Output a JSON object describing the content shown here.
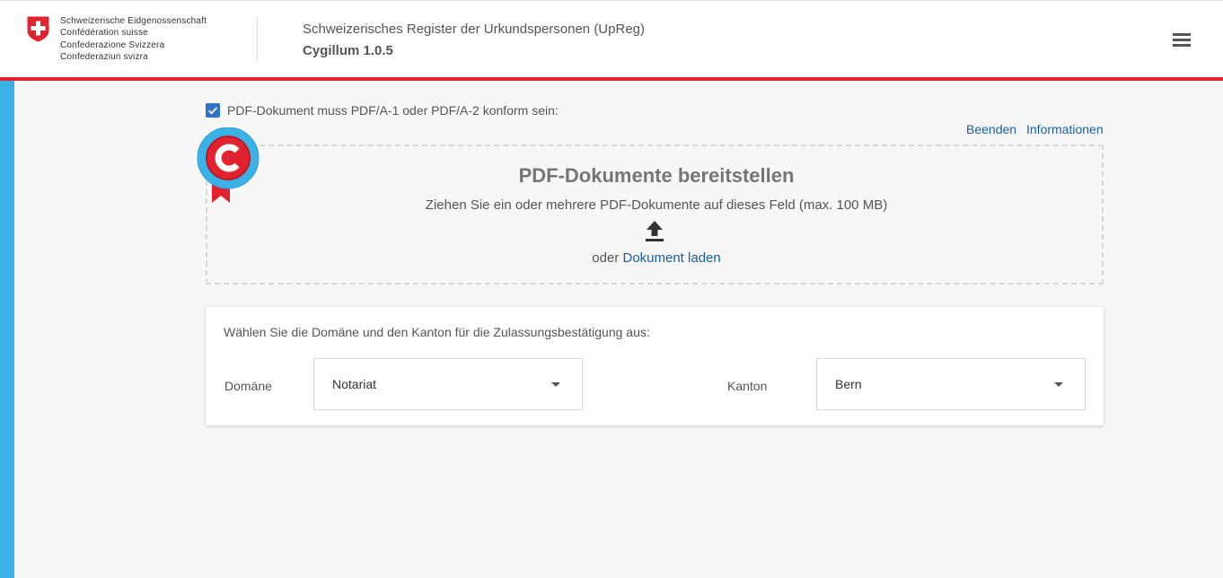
{
  "header": {
    "confederation_lines": [
      "Schweizerische Eidgenossenschaft",
      "Confédération suisse",
      "Confederazione Svizzera",
      "Confederaziun svizra"
    ],
    "title": "Schweizerisches Register der Urkundspersonen (UpReg)",
    "version": "Cygillum 1.0.5",
    "menu_icon": "hamburger-menu-icon"
  },
  "pdfa": {
    "checked": true,
    "label": "PDF-Dokument muss PDF/A-1 oder PDF/A-2 konform sein:"
  },
  "links": {
    "beenden": "Beenden",
    "informationen": "Informationen"
  },
  "dropzone": {
    "title": "PDF-Dokumente bereitstellen",
    "subtitle": "Ziehen Sie ein oder mehrere PDF-Dokumente auf dieses Feld (max. 100 MB)",
    "or_text": "oder ",
    "load_link": "Dokument laden",
    "icon": "upload-icon"
  },
  "selection": {
    "instruction": "Wählen Sie die Domäne und den Kanton für die Zulassungsbestätigung aus:",
    "domain_label": "Domäne",
    "domain_value": "Notariat",
    "kanton_label": "Kanton",
    "kanton_value": "Bern"
  },
  "colors": {
    "accent_red": "#e3222f",
    "side_blue": "#3ab2e8",
    "link_blue": "#1a5fa0",
    "checkbox_blue": "#2f73c8"
  }
}
